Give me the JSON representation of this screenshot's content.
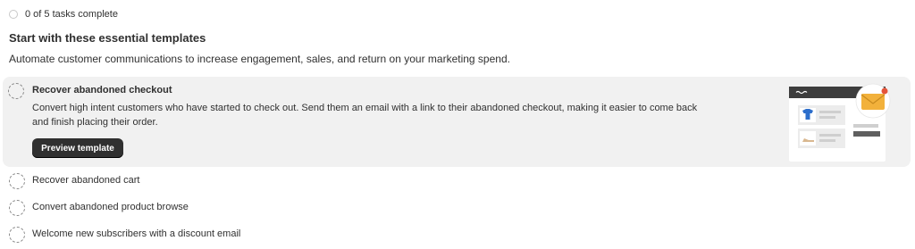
{
  "progress": {
    "text": "0 of 5 tasks complete"
  },
  "section": {
    "title": "Start with these essential templates",
    "subtitle": "Automate customer communications to increase engagement, sales, and return on your marketing spend."
  },
  "active_task": {
    "title": "Recover abandoned checkout",
    "description": "Convert high intent customers who have started to check out. Send them an email with a link to their abandoned checkout, making it easier to come back and finish placing their order.",
    "button_label": "Preview template",
    "illustration": "email-template-illustration"
  },
  "tasks": [
    {
      "label": "Recover abandoned cart"
    },
    {
      "label": "Convert abandoned product browse"
    },
    {
      "label": "Welcome new subscribers with a discount email"
    }
  ],
  "colors": {
    "button_bg": "#303030",
    "panel_bg": "#f1f1f1",
    "envelope": "#f2b13b",
    "notification_dot": "#e4543a",
    "tshirt": "#2c6ecb"
  }
}
